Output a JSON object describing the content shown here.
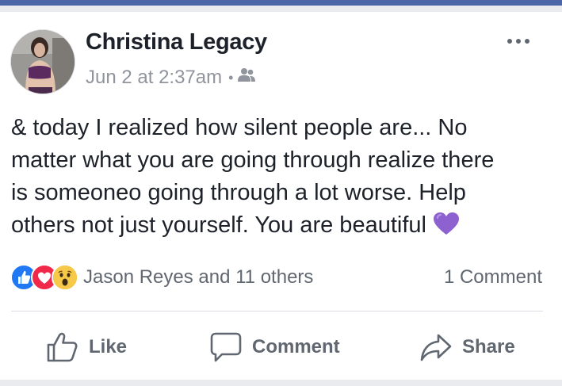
{
  "post": {
    "author": "Christina Legacy",
    "timestamp": "Jun 2 at 2:37am",
    "separator": "•",
    "audience_icon": "friends-icon",
    "more_icon": "more-options-icon",
    "text": "& today I realized how silent people are... No\nmatter what you are going through realize there\nis someoneo going through a lot worse. Help\nothers not just yourself. You are beautiful",
    "emoji": "purple-heart-icon"
  },
  "engagement": {
    "reaction_icons": [
      "like-icon",
      "love-icon",
      "wow-icon"
    ],
    "reactions_label": "Jason Reyes and 11 others",
    "comments_label": "1 Comment"
  },
  "actions": {
    "like": "Like",
    "comment": "Comment",
    "share": "Share"
  },
  "colors": {
    "brand_blue": "#4b67a8",
    "like_blue": "#2078f4",
    "love_red": "#f0284a",
    "wow_yellow": "#f7b125",
    "purple_heart": "#8e61d0",
    "secondary_text": "#606770"
  }
}
